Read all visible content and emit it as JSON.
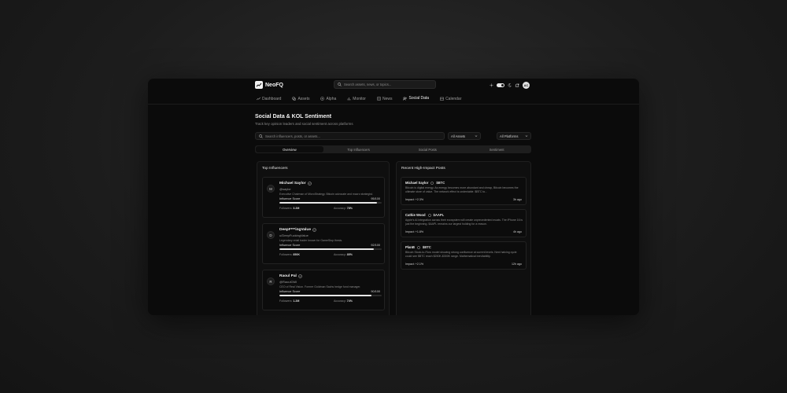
{
  "app": {
    "name": "NeoFQ"
  },
  "search": {
    "placeholder": "Search assets, news, or topics..."
  },
  "header": {
    "avatar_initials": "AC"
  },
  "nav": [
    {
      "label": "Dashboard",
      "icon": "trend-line-icon"
    },
    {
      "label": "Assets",
      "icon": "coins-icon"
    },
    {
      "label": "Alpha",
      "icon": "target-icon"
    },
    {
      "label": "Monitor",
      "icon": "bar-chart-icon"
    },
    {
      "label": "News",
      "icon": "newspaper-icon"
    },
    {
      "label": "Social Data",
      "icon": "users-icon",
      "active": true
    },
    {
      "label": "Calendar",
      "icon": "calendar-icon"
    }
  ],
  "page": {
    "title": "Social Data & KOL Sentiment",
    "subtitle": "Track key opinion leaders and social sentiment across platforms"
  },
  "filters": {
    "search_placeholder": "Search influencers, posts, or assets...",
    "assets_value": "All Assets",
    "platforms_value": "All Platforms"
  },
  "tabs": [
    "Overview",
    "Top Influencers",
    "Social Posts",
    "Sentiment"
  ],
  "top_influencers": {
    "title": "Top Influencers",
    "score_label": "Influence Score",
    "followers_label": "Followers:",
    "accuracy_label": "Accuracy:",
    "items": [
      {
        "initial": "M",
        "name": "Michael Saylor",
        "handle": "@saylor",
        "bio": "Executive Chairman of MicroStrategy. Bitcoin advocate and macro strategist.",
        "score": "95/100",
        "score_pct": 95,
        "followers": "3.2M",
        "accuracy": "78%"
      },
      {
        "initial": "D",
        "name": "DeepF***ingValue",
        "handle": "u/DeepFuckingValue",
        "bio": "Legendary retail trader known for GameStop thesis.",
        "score": "92/100",
        "score_pct": 92,
        "followers": "850K",
        "accuracy": "85%"
      },
      {
        "initial": "R",
        "name": "Raoul Pal",
        "handle": "@RaoulGMI",
        "bio": "CEO of Real Vision. Former Goldman Sachs hedge fund manager.",
        "score": "90/100",
        "score_pct": 90,
        "followers": "1.2M",
        "accuracy": "74%"
      }
    ]
  },
  "recent_posts": {
    "title": "Recent High-Impact Posts",
    "items": [
      {
        "author": "Michael Saylor",
        "ticker": "$BTC",
        "text": "Bitcoin is digital energy. As energy becomes more abundant and cheap, Bitcoin becomes the ultimate store of value. The network effect is undeniable. $BTC to...",
        "impact": "Impact: +2.3%",
        "time": "3h ago"
      },
      {
        "author": "Cathie Wood",
        "ticker": "$AAPL",
        "text": "Apple's AI integration across their ecosystem will create unprecedented moats. The iPhone 16 is just the beginning. $AAPL remains our largest holding for a reason.",
        "impact": "Impact: +1.8%",
        "time": "4h ago"
      },
      {
        "author": "PlanB",
        "ticker": "$BTC",
        "text": "Bitcoin Stock-to-Flow model showing strong confluence at current levels. Next halving cycle could see $BTC reach $250K-$300K range. Mathematical inevitability.",
        "impact": "Impact: +2.1%",
        "time": "12h ago"
      }
    ]
  }
}
